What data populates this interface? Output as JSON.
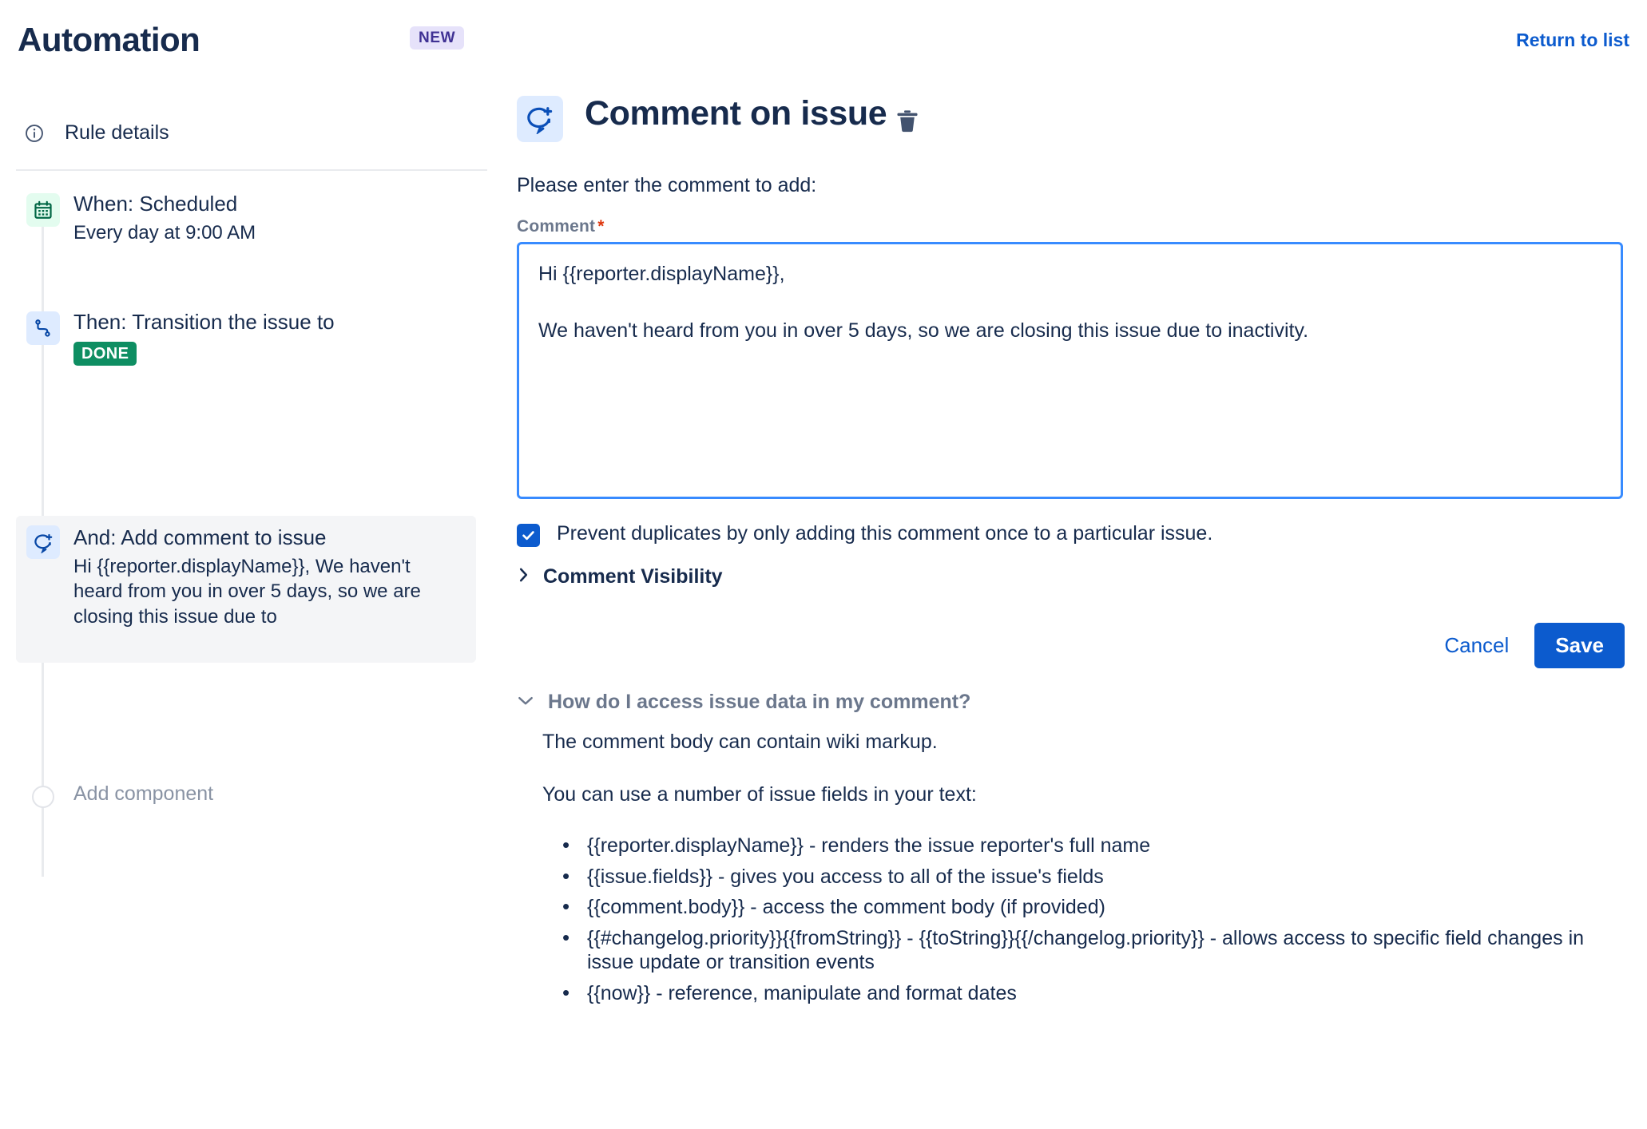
{
  "header": {
    "title": "Automation",
    "badge": "NEW",
    "return_link": "Return to list"
  },
  "sidebar": {
    "rule_details": "Rule details",
    "nodes": [
      {
        "title": "When: Scheduled",
        "subtitle": "Every day at 9:00 AM",
        "icon": "calendar-icon",
        "icon_bg": "#E3FCEF",
        "selected": false,
        "badge": null
      },
      {
        "title": "Then: Transition the issue to",
        "subtitle": "",
        "icon": "transition-icon",
        "icon_bg": "#DEEBFF",
        "selected": false,
        "badge": "DONE"
      },
      {
        "title": "And: Add comment to issue",
        "subtitle": "Hi {{reporter.displayName}}, We haven't heard from you in over 5 days, so we are closing this issue due to",
        "icon": "add-comment-icon",
        "icon_bg": "#DEEBFF",
        "selected": true,
        "badge": null
      }
    ],
    "add_component": "Add component"
  },
  "main": {
    "title": "Comment on issue",
    "icon": "add-comment-icon",
    "delete_icon": "trash-icon",
    "instruction": "Please enter the comment to add:",
    "comment_field_label": "Comment",
    "required_marker": "*",
    "comment_value": "Hi {{reporter.displayName}},\n\nWe haven't heard from you in over 5 days, so we are closing this issue due to inactivity.",
    "prevent_duplicates_label": "Prevent duplicates by only adding this comment once to a particular issue.",
    "prevent_duplicates_checked": true,
    "comment_visibility_label": "Comment Visibility",
    "comment_visibility_expanded": false,
    "cancel_label": "Cancel",
    "save_label": "Save"
  },
  "help": {
    "title": "How do I access issue data in my comment?",
    "expanded": true,
    "paragraph1": "The comment body can contain wiki markup.",
    "paragraph2": "You can use a number of issue fields in your text:",
    "items": [
      "{{reporter.displayName}} - renders the issue reporter's full name",
      "{{issue.fields}} - gives you access to all of the issue's fields",
      "{{comment.body}} - access the comment body (if provided)",
      "{{#changelog.priority}}{{fromString}} - {{toString}}{{/changelog.priority}} - allows access to specific field changes in issue update or transition events",
      "{{now}} - reference, manipulate and format dates"
    ]
  },
  "colors": {
    "accent_blue": "#0C5BCE",
    "focus_border": "#388BFF",
    "text": "#172B4D",
    "subtle_text": "#6B778C",
    "done_green": "#0E8E62",
    "badge_purple_bg": "#E6E2FA",
    "badge_purple_text": "#403294",
    "required_red": "#DE350B"
  }
}
